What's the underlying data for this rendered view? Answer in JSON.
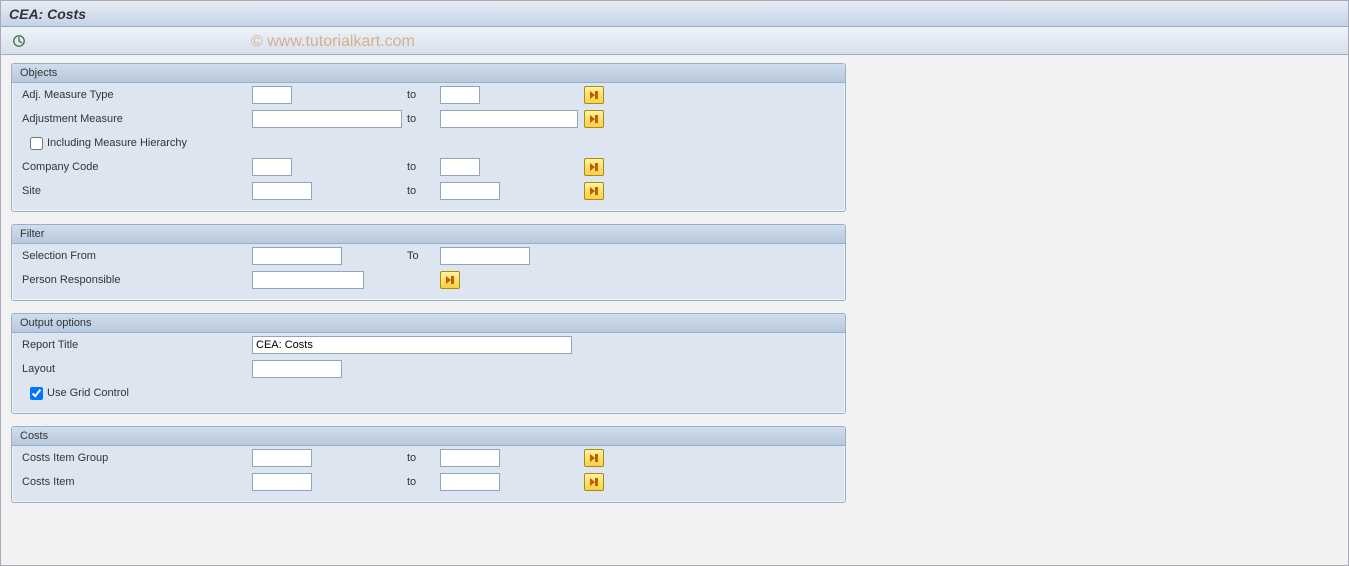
{
  "title": "CEA: Costs",
  "watermark": "© www.tutorialkart.com",
  "groups": {
    "objects": {
      "title": "Objects",
      "adj_measure_type": {
        "label": "Adj. Measure Type",
        "from": "",
        "to_label": "to",
        "to": ""
      },
      "adjustment_measure": {
        "label": "Adjustment Measure",
        "from": "",
        "to_label": "to",
        "to": ""
      },
      "including_hierarchy": {
        "label": "Including Measure Hierarchy",
        "checked": false
      },
      "company_code": {
        "label": "Company Code",
        "from": "",
        "to_label": "to",
        "to": ""
      },
      "site": {
        "label": "Site",
        "from": "",
        "to_label": "to",
        "to": ""
      }
    },
    "filter": {
      "title": "Filter",
      "selection_from": {
        "label": "Selection From",
        "from": "",
        "to_label": "To",
        "to": ""
      },
      "person_responsible": {
        "label": "Person Responsible",
        "value": ""
      }
    },
    "output": {
      "title": "Output options",
      "report_title": {
        "label": "Report Title",
        "value": "CEA: Costs"
      },
      "layout": {
        "label": "Layout",
        "value": ""
      },
      "use_grid": {
        "label": "Use Grid Control",
        "checked": true
      }
    },
    "costs": {
      "title": "Costs",
      "costs_item_group": {
        "label": "Costs Item Group",
        "from": "",
        "to_label": "to",
        "to": ""
      },
      "costs_item": {
        "label": "Costs Item",
        "from": "",
        "to_label": "to",
        "to": ""
      }
    }
  }
}
